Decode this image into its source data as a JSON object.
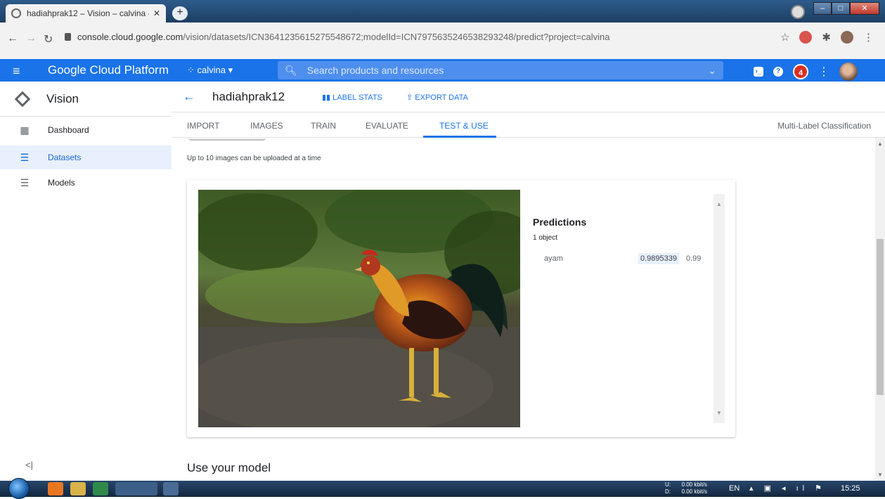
{
  "browser": {
    "tab_title": "hadiahprak12 – Vision – calvina –",
    "url_host": "console.cloud.google.com",
    "url_path": "/vision/datasets/ICN3641235615275548672;modelId=ICN7975635246538293248/predict?project=calvina"
  },
  "header": {
    "brand": "Google Cloud Platform",
    "project": "calvina",
    "search_placeholder": "Search products and resources",
    "notification_count": "4",
    "accent_color": "#1a73e8"
  },
  "sidebar": {
    "title": "Vision",
    "items": [
      {
        "label": "Dashboard",
        "icon": "dashboard-icon"
      },
      {
        "label": "Datasets",
        "icon": "list-icon"
      },
      {
        "label": "Models",
        "icon": "list-icon"
      }
    ],
    "active": "Datasets"
  },
  "dataset": {
    "name": "hadiahprak12",
    "label_stats": "LABEL STATS",
    "export_data": "EXPORT DATA"
  },
  "tabs": [
    "IMPORT",
    "IMAGES",
    "TRAIN",
    "EVALUATE",
    "TEST & USE"
  ],
  "active_tab": "TEST & USE",
  "classification_type": "Multi-Label Classification",
  "upload_note": "Up to 10 images can be uploaded at a time",
  "predictions": {
    "title": "Predictions",
    "count": "1 object",
    "items": [
      {
        "label": "ayam",
        "score": "0.9895339",
        "rounded": "0.99"
      }
    ]
  },
  "use_model_heading": "Use your model",
  "taskbar": {
    "net_up": "0.00 kbit/s",
    "net_down": "0.00 kbit/s",
    "net_up_label": "U:",
    "net_down_label": "D:",
    "language": "EN",
    "time": "15:25"
  }
}
